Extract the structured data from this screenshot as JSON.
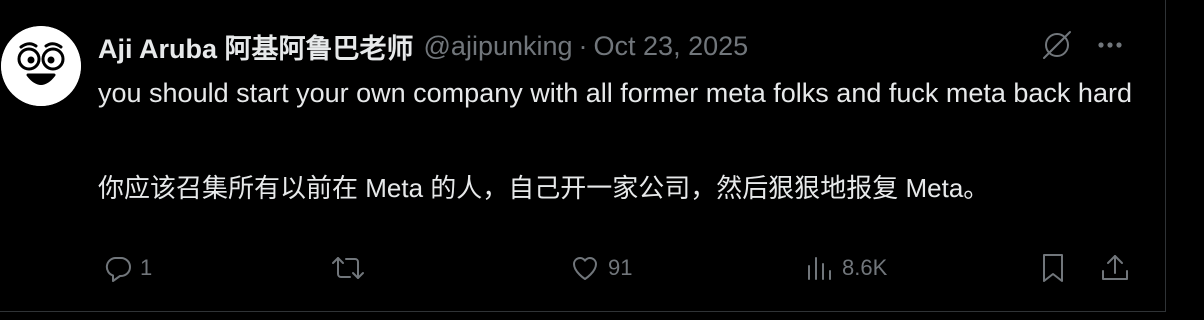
{
  "tweet": {
    "display_name": "Aji Aruba 阿基阿鲁巴老师",
    "handle": "@ajipunking",
    "separator": "·",
    "date": "Oct 23, 2025",
    "text_en": "you should start your own company with all former meta folks and fuck meta back hard",
    "text_zh": "你应该召集所有以前在 Meta 的人，自己开一家公司，然后狠狠地报复 Meta。"
  },
  "actions": {
    "replies": "1",
    "retweets": "",
    "likes": "91",
    "views": "8.6K"
  },
  "icons": {
    "top": [
      "grok-icon",
      "more-icon"
    ],
    "actions": [
      "reply-icon",
      "retweet-icon",
      "like-icon",
      "views-icon",
      "bookmark-icon",
      "share-icon"
    ]
  },
  "colors": {
    "background": "#000000",
    "text_primary": "#e7e9ea",
    "text_secondary": "#71767b",
    "border": "#2f3336"
  }
}
